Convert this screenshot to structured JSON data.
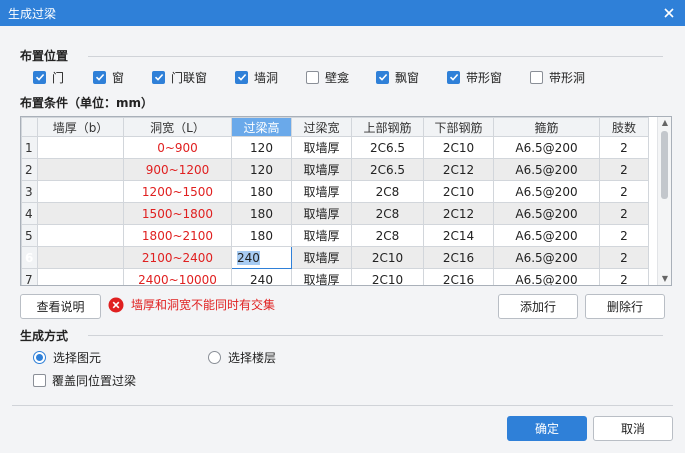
{
  "window": {
    "title": "生成过梁",
    "close_icon": "close-icon"
  },
  "placement": {
    "title": "布置位置",
    "options": [
      {
        "label": "门",
        "checked": true
      },
      {
        "label": "窗",
        "checked": true
      },
      {
        "label": "门联窗",
        "checked": true
      },
      {
        "label": "墙洞",
        "checked": true
      },
      {
        "label": "壁龛",
        "checked": false
      },
      {
        "label": "飘窗",
        "checked": true
      },
      {
        "label": "带形窗",
        "checked": true
      },
      {
        "label": "带形洞",
        "checked": false
      }
    ]
  },
  "conditions": {
    "title": "布置条件（单位：mm）",
    "columns": [
      "",
      "墙厚（b）",
      "洞宽（L）",
      "过梁高",
      "过梁宽",
      "上部钢筋",
      "下部钢筋",
      "箍筋",
      "肢数"
    ],
    "active_column": 3,
    "active_row": 5,
    "rows": [
      [
        "1",
        "",
        "0~900",
        "120",
        "取墙厚",
        "2C6.5",
        "2C10",
        "A6.5@200",
        "2"
      ],
      [
        "2",
        "",
        "900~1200",
        "120",
        "取墙厚",
        "2C6.5",
        "2C12",
        "A6.5@200",
        "2"
      ],
      [
        "3",
        "",
        "1200~1500",
        "180",
        "取墙厚",
        "2C8",
        "2C10",
        "A6.5@200",
        "2"
      ],
      [
        "4",
        "",
        "1500~1800",
        "180",
        "取墙厚",
        "2C8",
        "2C12",
        "A6.5@200",
        "2"
      ],
      [
        "5",
        "",
        "1800~2100",
        "180",
        "取墙厚",
        "2C8",
        "2C14",
        "A6.5@200",
        "2"
      ],
      [
        "6",
        "",
        "2100~2400",
        "240",
        "取墙厚",
        "2C10",
        "2C16",
        "A6.5@200",
        "2"
      ],
      [
        "7",
        "",
        "2400~10000",
        "240",
        "取墙厚",
        "2C10",
        "2C16",
        "A6.5@200",
        "2"
      ]
    ],
    "red_column": 2,
    "view_help_label": "查看说明",
    "warning_text": "墙厚和洞宽不能同时有交集",
    "add_row_label": "添加行",
    "delete_row_label": "删除行",
    "warning_color": "#e02020"
  },
  "generate": {
    "title": "生成方式",
    "radio_options": [
      {
        "label": "选择图元",
        "selected": true
      },
      {
        "label": "选择楼层",
        "selected": false
      }
    ],
    "overwrite_label": "覆盖同位置过梁",
    "overwrite_checked": false
  },
  "footer": {
    "ok_label": "确定",
    "cancel_label": "取消"
  },
  "colors": {
    "accent": "#2f80d8",
    "header_active": "#6aa9ea"
  }
}
